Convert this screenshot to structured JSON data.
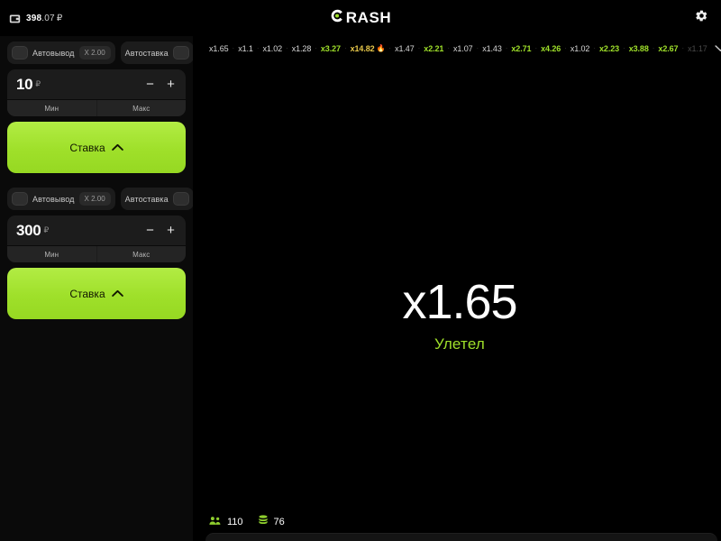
{
  "app": {
    "brand_name": "RASH",
    "brand_full": "CRASH",
    "accent_green": "#9fe02a",
    "gold": "#e8c84a",
    "background": "#000000"
  },
  "topbar": {
    "wallet_icon": "wallet-icon",
    "balance_int": "398",
    "balance_frac": ".07",
    "currency": "₽",
    "settings_icon": "gear-icon"
  },
  "sidebar": {
    "panels": [
      {
        "id": "bet-panel-1",
        "auto_cashout_label": "Автовывод",
        "auto_cashout_multiplier": "X 2.00",
        "auto_cashout_on": false,
        "auto_bet_label": "Автоставка",
        "auto_bet_on": false,
        "amount": "10",
        "currency": "₽",
        "minus_label": "−",
        "plus_label": "+",
        "min_label": "Мин",
        "max_label": "Макс",
        "bet_label": "Ставка"
      },
      {
        "id": "bet-panel-2",
        "auto_cashout_label": "Автовывод",
        "auto_cashout_multiplier": "X 2.00",
        "auto_cashout_on": false,
        "auto_bet_label": "Автоставка",
        "auto_bet_on": false,
        "amount": "300",
        "currency": "₽",
        "minus_label": "−",
        "plus_label": "+",
        "min_label": "Мин",
        "max_label": "Макс",
        "bet_label": "Ставка"
      }
    ]
  },
  "history": {
    "expand_icon": "chevron-down-icon",
    "items": [
      {
        "label": "x1.65",
        "tier": "low"
      },
      {
        "label": "x1.1",
        "tier": "low"
      },
      {
        "label": "x1.02",
        "tier": "low"
      },
      {
        "label": "x1.28",
        "tier": "low"
      },
      {
        "label": "x3.27",
        "tier": "mid"
      },
      {
        "label": "x14.82",
        "tier": "high",
        "fire": true
      },
      {
        "label": "x1.47",
        "tier": "low"
      },
      {
        "label": "x2.21",
        "tier": "mid"
      },
      {
        "label": "x1.07",
        "tier": "low"
      },
      {
        "label": "x1.43",
        "tier": "low"
      },
      {
        "label": "x2.71",
        "tier": "mid"
      },
      {
        "label": "x4.26",
        "tier": "mid"
      },
      {
        "label": "x1.02",
        "tier": "low"
      },
      {
        "label": "x2.23",
        "tier": "mid"
      },
      {
        "label": "x3.88",
        "tier": "mid"
      },
      {
        "label": "x2.67",
        "tier": "mid"
      },
      {
        "label": "x1.17",
        "tier": "faded"
      }
    ]
  },
  "stage": {
    "multiplier": "x1.65",
    "status": "Улетел",
    "players_icon": "players-icon",
    "players_count": "110",
    "coins_icon": "coins-icon",
    "coins_count": "76"
  }
}
